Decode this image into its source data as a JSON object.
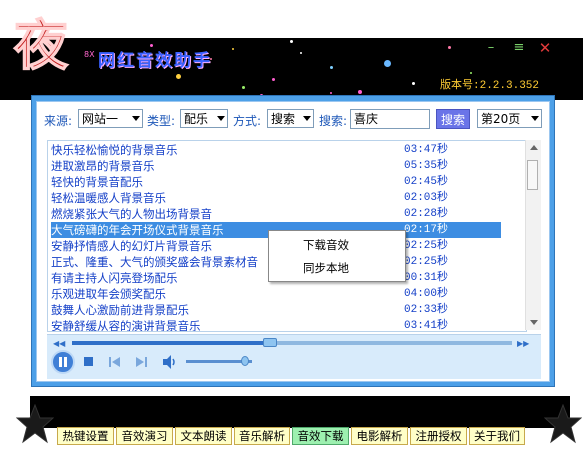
{
  "window": {
    "title": "网红音效助手",
    "title_small": "8X",
    "version": "版本号:2.2.3.352",
    "logo_char": "夜"
  },
  "filters": {
    "source_label": "来源:",
    "source_value": "网站一",
    "type_label": "类型:",
    "type_value": "配乐",
    "mode_label": "方式:",
    "mode_value": "搜索",
    "search_label": "搜索:",
    "search_value": "喜庆",
    "search_button": "搜索",
    "page_value": "第20页"
  },
  "list": {
    "rows": [
      {
        "title": "快乐轻松愉悦的背景音乐",
        "duration": "03:47秒"
      },
      {
        "title": "进取激昂的背景音乐",
        "duration": "05:35秒"
      },
      {
        "title": "轻快的背景音配乐",
        "duration": "02:45秒"
      },
      {
        "title": "轻松温暖感人背景音乐",
        "duration": "02:03秒"
      },
      {
        "title": "燃烧紧张大气的人物出场背景音",
        "duration": "02:28秒"
      },
      {
        "title": "大气磅礴的年会开场仪式背景音乐",
        "duration": "02:17秒"
      },
      {
        "title": "安静抒情感人的幻灯片背景音乐",
        "duration": "02:25秒"
      },
      {
        "title": "正式、隆重、大气的颁奖盛会背景素材音",
        "duration": "02:25秒"
      },
      {
        "title": "有请主持人闪亮登场配乐",
        "duration": "00:31秒"
      },
      {
        "title": "乐观进取年会颁奖配乐",
        "duration": "04:00秒"
      },
      {
        "title": "鼓舞人心激励前进背景配乐",
        "duration": "02:33秒"
      },
      {
        "title": "安静舒缓从容的演讲背景音乐",
        "duration": "03:41秒"
      }
    ]
  },
  "context_menu": {
    "download": "下载音效",
    "sync_local": "同步本地"
  },
  "player": {
    "progress": 0.45,
    "volume": 0.9
  },
  "tabs": [
    {
      "label": "热键设置"
    },
    {
      "label": "音效演习"
    },
    {
      "label": "文本朗读"
    },
    {
      "label": "音乐解析"
    },
    {
      "label": "音效下载"
    },
    {
      "label": "电影解析"
    },
    {
      "label": "注册授权"
    },
    {
      "label": "关于我们"
    }
  ],
  "colors": {
    "accent": "#4da0e8",
    "selected_row": "#3d8de2",
    "active_tab": "#9df0b0"
  }
}
